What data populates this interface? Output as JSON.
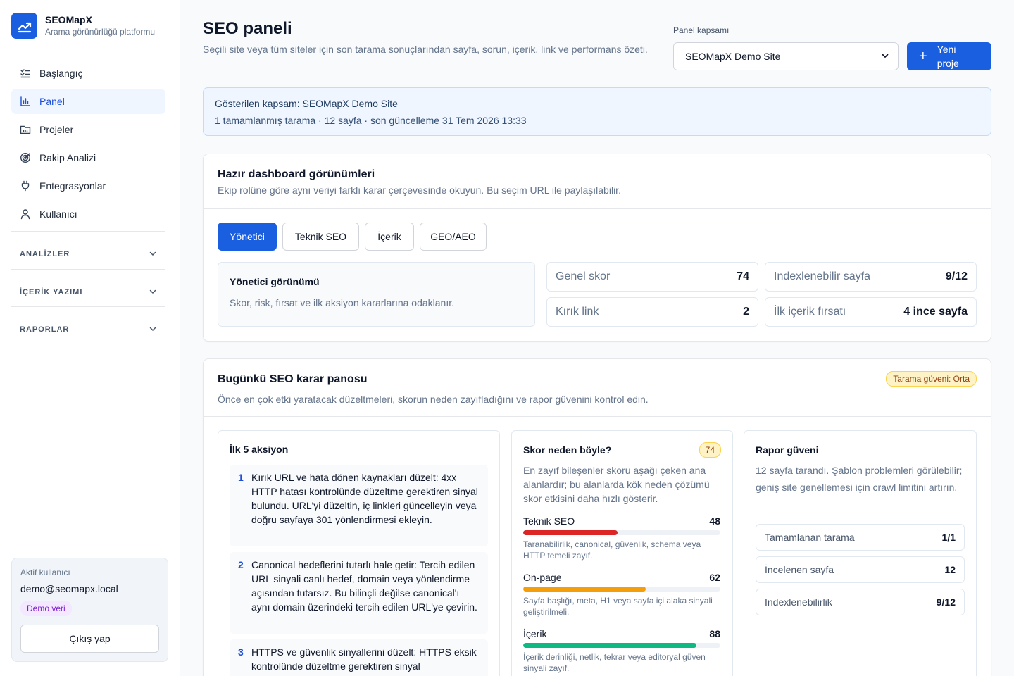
{
  "colors": {
    "accent": "#1a5fe0",
    "danger": "#dc2626",
    "warning": "#f59e0b",
    "success": "#10b981"
  },
  "brand": {
    "name": "SEOMapX",
    "tagline": "Arama görünürlüğü platformu",
    "icon": "trend-chart-icon"
  },
  "nav": {
    "items": [
      {
        "label": "Başlangıç",
        "icon": "checklist-icon"
      },
      {
        "label": "Panel",
        "icon": "bar-chart-icon",
        "active": true
      },
      {
        "label": "Projeler",
        "icon": "folder-chart-icon"
      },
      {
        "label": "Rakip Analizi",
        "icon": "target-icon"
      },
      {
        "label": "Entegrasyonlar",
        "icon": "plug-icon"
      },
      {
        "label": "Kullanıcı",
        "icon": "user-icon"
      }
    ],
    "groups": [
      {
        "label": "ANALİZLER"
      },
      {
        "label": "İÇERİK YAZIMI"
      },
      {
        "label": "RAPORLAR"
      }
    ]
  },
  "user": {
    "label": "Aktif kullanıcı",
    "email": "demo@seomapx.local",
    "badge": "Demo veri",
    "logout": "Çıkış yap"
  },
  "header": {
    "title": "SEO paneli",
    "description": "Seçili site veya tüm siteler için son tarama sonuçlarından sayfa, sorun, içerik, link ve performans özeti.",
    "scope_label": "Panel kapsamı",
    "scope_value": "SEOMapX Demo Site",
    "new_project": "Yeni proje"
  },
  "banner": {
    "title": "Gösterilen kapsam: SEOMapX Demo Site",
    "sub": "1 tamamlanmış tarama · 12 sayfa · son güncelleme 31 Tem 2026 13:33"
  },
  "views": {
    "title": "Hazır dashboard görünümleri",
    "subtitle": "Ekip rolüne göre aynı veriyi farklı karar çerçevesinde okuyun. Bu seçim URL ile paylaşılabilir.",
    "tabs": [
      "Yönetici",
      "Teknik SEO",
      "İçerik",
      "GEO/AEO"
    ],
    "active_title": "Yönetici görünümü",
    "active_desc": "Skor, risk, fırsat ve ilk aksiyon kararlarına odaklanır.",
    "metrics": [
      {
        "label": "Genel skor",
        "value": "74"
      },
      {
        "label": "Indexlenebilir sayfa",
        "value": "9/12"
      },
      {
        "label": "Kırık link",
        "value": "2"
      },
      {
        "label": "İlk içerik fırsatı",
        "value": "4 ince sayfa"
      }
    ]
  },
  "decision": {
    "title": "Bugünkü SEO karar panosu",
    "subtitle": "Önce en çok etki yaratacak düzeltmeleri, skorun neden zayıfladığını ve rapor güvenini kontrol edin.",
    "confidence": "Tarama güveni: Orta",
    "actions_title": "İlk 5 aksiyon",
    "actions": [
      {
        "num": "1",
        "text": "Kırık URL ve hata dönen kaynakları düzelt: 4xx HTTP hatası kontrolünde düzeltme gerektiren sinyal bulundu. URL'yi düzeltin, iç linkleri güncelleyin veya doğru sayfaya 301 yönlendirmesi ekleyin."
      },
      {
        "num": "2",
        "text": "Canonical hedeflerini tutarlı hale getir: Tercih edilen URL sinyali canlı hedef, domain veya yönlendirme açısından tutarsız. Bu bilinçli değilse canonical'ı aynı domain üzerindeki tercih edilen URL'ye çevirin."
      },
      {
        "num": "3",
        "text": "HTTPS ve güvenlik sinyallerini düzelt: HTTPS eksik kontrolünde düzeltme gerektiren sinyal"
      }
    ],
    "score_title": "Skor neden böyle?",
    "score_badge": "74",
    "score_desc": "En zayıf bileşenler skoru aşağı çeken ana alanlardır; bu alanlarda kök neden çözümü skor etkisini daha hızlı gösterir.",
    "components": [
      {
        "label": "Teknik SEO",
        "value": 48,
        "note": "Taranabilirlik, canonical, güvenlik, schema veya HTTP temeli zayıf.",
        "color": "#dc2626"
      },
      {
        "label": "On-page",
        "value": 62,
        "note": "Sayfa başlığı, meta, H1 veya sayfa içi alaka sinyali geliştirilmeli.",
        "color": "#f59e0b"
      },
      {
        "label": "İçerik",
        "value": 88,
        "note": "İçerik derinliği, netlik, tekrar veya editoryal güven sinyali zayıf.",
        "color": "#10b981"
      }
    ],
    "report_title": "Rapor güveni",
    "report_desc": "12 sayfa tarandı. Şablon problemleri görülebilir; geniş site genellemesi için crawl limitini artırın.",
    "stats": [
      {
        "label": "Tamamlanan tarama",
        "value": "1/1"
      },
      {
        "label": "İncelenen sayfa",
        "value": "12"
      },
      {
        "label": "Indexlenebilirlik",
        "value": "9/12"
      }
    ]
  }
}
